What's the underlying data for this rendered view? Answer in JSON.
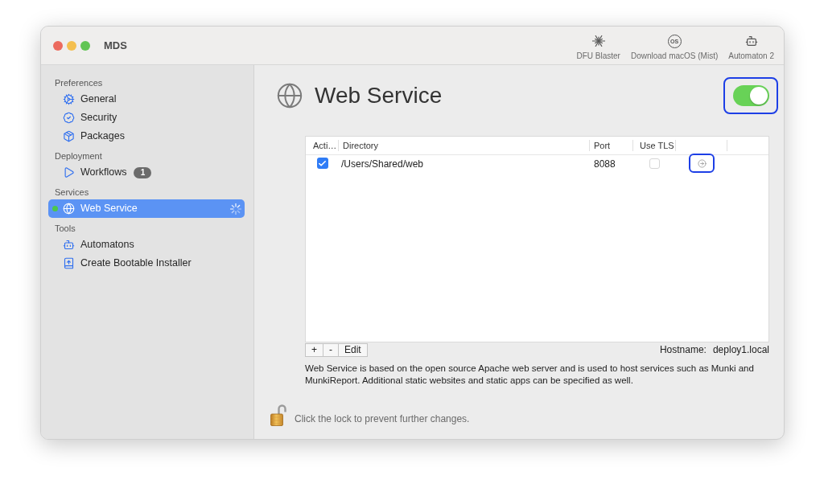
{
  "window": {
    "title": "MDS"
  },
  "toolbar": [
    {
      "label": "DFU Blaster"
    },
    {
      "label": "Download macOS (Mist)",
      "icon_text": "OS"
    },
    {
      "label": "Automaton 2"
    }
  ],
  "sidebar": {
    "sections": [
      {
        "title": "Preferences",
        "items": [
          {
            "label": "General",
            "selected": false
          },
          {
            "label": "Security",
            "selected": false
          },
          {
            "label": "Packages",
            "selected": false
          }
        ]
      },
      {
        "title": "Deployment",
        "items": [
          {
            "label": "Workflows",
            "selected": false,
            "badge": "1"
          }
        ]
      },
      {
        "title": "Services",
        "items": [
          {
            "label": "Web Service",
            "selected": true,
            "running": true,
            "busy": true
          }
        ]
      },
      {
        "title": "Tools",
        "items": [
          {
            "label": "Automatons",
            "selected": false
          },
          {
            "label": "Create Bootable Installer",
            "selected": false
          }
        ]
      }
    ]
  },
  "header": {
    "title": "Web Service",
    "enabled": true,
    "highlighted": true
  },
  "table": {
    "columns": [
      "Acti…",
      "Directory",
      "Port",
      "Use TLS"
    ],
    "rows": [
      {
        "active": true,
        "directory": "/Users/Shared/web",
        "port": "8088",
        "use_tls": false,
        "highlighted": true
      }
    ]
  },
  "table_buttons": [
    "+",
    "-",
    "Edit"
  ],
  "hostname": {
    "label": "Hostname:",
    "value": "deploy1.local"
  },
  "description": "Web Service is based on the open source Apache web server and is used to host services such as Munki and MunkiReport. Additional static websites and static apps can be specified as well.",
  "lock": {
    "locked": false,
    "text": "Click the lock to prevent further changes."
  }
}
